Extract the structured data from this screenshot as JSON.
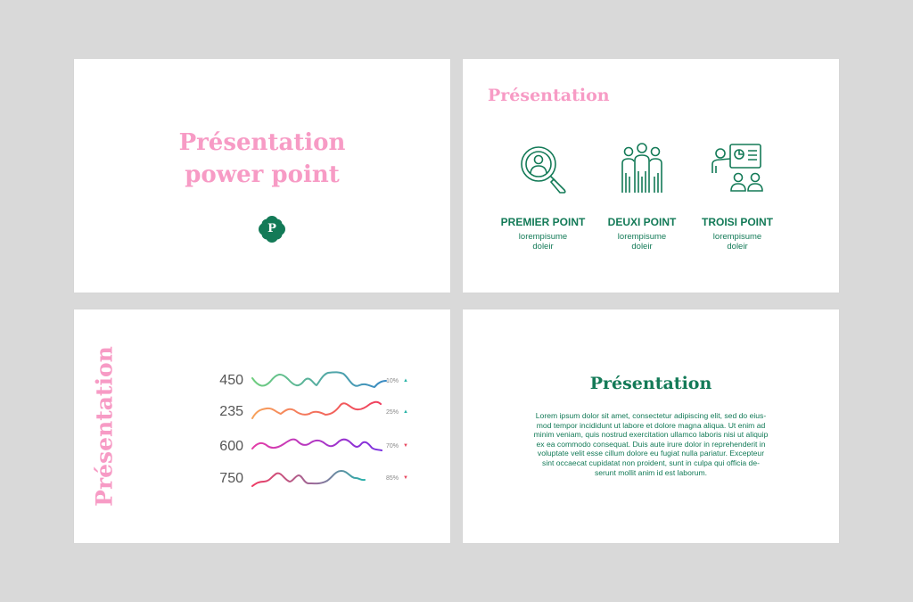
{
  "colors": {
    "background": "#d9d9d9",
    "pink": "#f79bc5",
    "green": "#137a57"
  },
  "slide1": {
    "title_line1": "Présentation",
    "title_line2": "power point",
    "badge_letter": "P"
  },
  "slide2": {
    "title": "Présentation",
    "features": [
      {
        "title": "PREMIER POINT",
        "desc_line1": "lorempisume",
        "desc_line2": "doleir",
        "icon": "search-person-icon"
      },
      {
        "title": "DEUXI POINT",
        "desc_line1": "lorempisume",
        "desc_line2": "doleir",
        "icon": "team-icon"
      },
      {
        "title": "TROISI POINT",
        "desc_line1": "lorempisume",
        "desc_line2": "doleir",
        "icon": "presentation-icon"
      }
    ]
  },
  "slide3": {
    "vertical_title": "Présentation",
    "rows": [
      {
        "value": "450",
        "percent": "10%",
        "arrow": "▲",
        "arrow_color": "#2bb5a8"
      },
      {
        "value": "235",
        "percent": "25%",
        "arrow": "▲",
        "arrow_color": "#2bb5a8"
      },
      {
        "value": "600",
        "percent": "70%",
        "arrow": "▼",
        "arrow_color": "#e8475f"
      },
      {
        "value": "750",
        "percent": "85%",
        "arrow": "▼",
        "arrow_color": "#e8475f"
      }
    ]
  },
  "slide4": {
    "title": "Présentation",
    "body_lines": [
      "Lorem ipsum dolor sit amet, consectetur adipiscing elit, sed do eius-",
      "mod tempor incididunt ut labore et dolore magna aliqua. Ut enim ad",
      "minim veniam, quis nostrud exercitation ullamco laboris nisi ut aliquip",
      "ex ea commodo consequat. Duis aute irure dolor in reprehenderit in",
      "voluptate velit esse cillum dolore eu fugiat nulla pariatur. Excepteur",
      "sint occaecat cupidatat non proident, sunt in culpa qui officia de-",
      "serunt mollit anim id est laborum."
    ]
  }
}
